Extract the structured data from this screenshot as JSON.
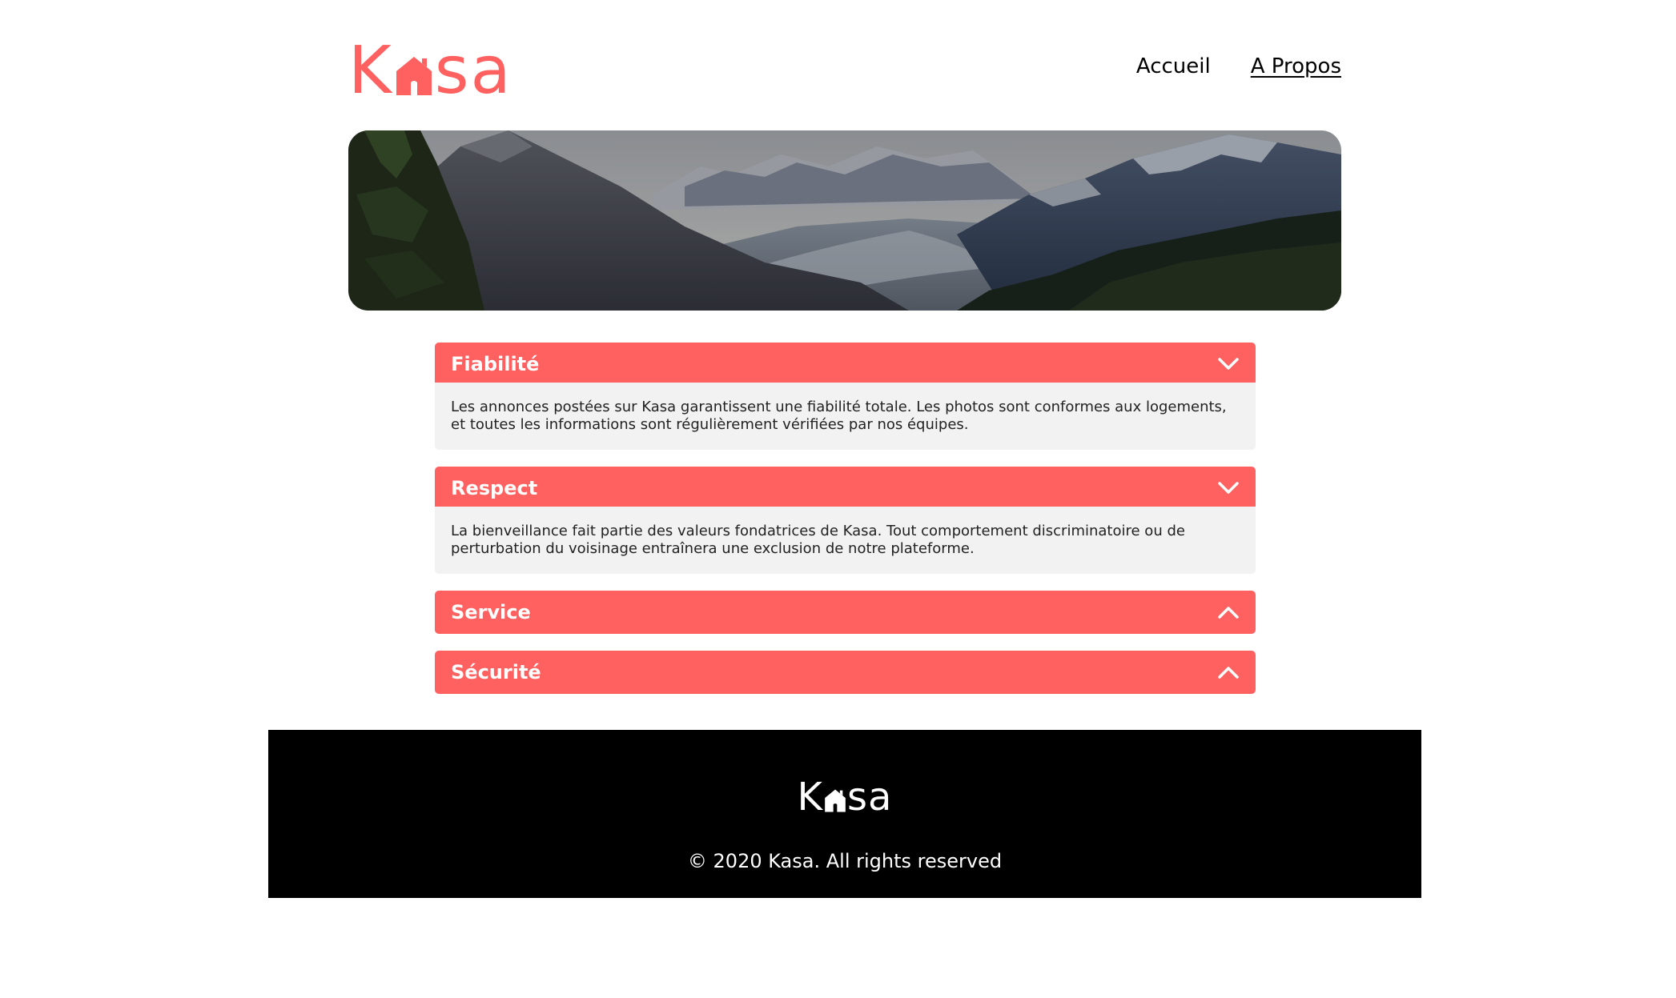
{
  "brand": {
    "logo_k": "K",
    "logo_sa": "sa",
    "accent_color": "#ff6060"
  },
  "nav": {
    "home_label": "Accueil",
    "about_label": "A Propos"
  },
  "banner": {
    "image": "mountain-valley-landscape"
  },
  "accordion": [
    {
      "title": "Fiabilité",
      "icon": "chevron-down-icon",
      "text": "Les annonces postées sur Kasa garantissent une fiabilité totale. Les photos sont conformes aux logements, et toutes les informations sont régulièrement vérifiées par nos équipes."
    },
    {
      "title": "Respect",
      "icon": "chevron-down-icon",
      "text": "La bienveillance fait partie des valeurs fondatrices de Kasa. Tout comportement discriminatoire ou de perturbation du voisinage entraînera une exclusion de notre plateforme."
    },
    {
      "title": "Service",
      "icon": "chevron-up-icon"
    },
    {
      "title": "Sécurité",
      "icon": "chevron-up-icon"
    }
  ],
  "footer": {
    "logo_k": "K",
    "logo_sa": "sa",
    "copyright": "© 2020 Kasa. All rights reserved"
  }
}
